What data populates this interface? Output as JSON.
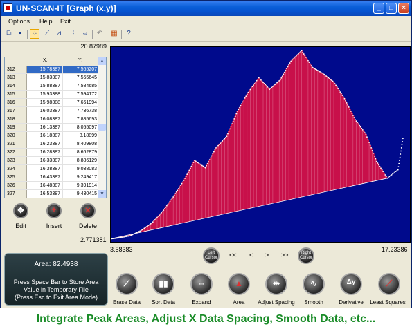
{
  "window": {
    "title": "UN-SCAN-IT [Graph (x,y)]",
    "buttons": {
      "minimize": "_",
      "maximize": "□",
      "close": "×"
    }
  },
  "menu": [
    "Options",
    "Help",
    "Exit"
  ],
  "axis": {
    "ymax": "20.87989",
    "ymin": "2.771381",
    "xmin": "3.58383",
    "xmax": "17.23386"
  },
  "table": {
    "columns": [
      "X:",
      "Y:"
    ],
    "rows": [
      [
        "312",
        "15.78387",
        "7.565207"
      ],
      [
        "313",
        "15.83387",
        "7.565645"
      ],
      [
        "314",
        "15.88387",
        "7.584685"
      ],
      [
        "315",
        "15.93388",
        "7.594172"
      ],
      [
        "316",
        "15.98388",
        "7.661994"
      ],
      [
        "317",
        "16.03387",
        "7.736738"
      ],
      [
        "318",
        "16.08387",
        "7.885693"
      ],
      [
        "319",
        "16.13387",
        "8.055097"
      ],
      [
        "320",
        "16.18387",
        "8.18899"
      ],
      [
        "321",
        "16.23387",
        "8.409808"
      ],
      [
        "322",
        "16.28387",
        "8.662879"
      ],
      [
        "323",
        "16.33387",
        "8.886129"
      ],
      [
        "324",
        "16.38387",
        "9.038083"
      ],
      [
        "325",
        "16.43387",
        "9.249417"
      ],
      [
        "326",
        "16.48387",
        "9.391914"
      ],
      [
        "327",
        "16.53387",
        "9.430415"
      ]
    ]
  },
  "edit_buttons": [
    "Edit",
    "Insert",
    "Delete"
  ],
  "cursor": {
    "left": "Left Cursor",
    "right": "Right Cursor",
    "nav": [
      "<<",
      "<",
      ">",
      ">>"
    ]
  },
  "area_panel": {
    "area": "Area: 82.4938",
    "line1": "Press Space Bar to Store Area",
    "line2": "Value in Temporary File",
    "line3": "(Press Esc to Exit Area Mode)"
  },
  "functions": [
    "Erase Data",
    "Sort Data",
    "Expand",
    "Area",
    "Adjust Spacing",
    "Smooth",
    "Derivative",
    "Least Squares"
  ],
  "caption": "Integrate Peak Areas, Adjust X Data Spacing, Smooth Data, etc...",
  "colors": {
    "plot_bg": "#000a8c",
    "fill": "#c8104a",
    "points": "#ffffff",
    "caption": "#1a8c28"
  },
  "chart_data": {
    "type": "area",
    "xlim": [
      3.58383,
      17.23386
    ],
    "ylim": [
      2.771381,
      20.87989
    ],
    "x": [
      3.58,
      4.0,
      4.5,
      5.0,
      5.5,
      6.0,
      6.5,
      7.0,
      7.5,
      8.0,
      8.5,
      9.0,
      9.5,
      10.0,
      10.5,
      11.0,
      11.5,
      12.0,
      12.5,
      13.0,
      13.5,
      14.0,
      14.5,
      15.0,
      15.5,
      16.0,
      16.5,
      17.0,
      17.23
    ],
    "y": [
      2.8,
      2.9,
      3.1,
      3.6,
      4.3,
      5.4,
      6.8,
      8.4,
      10.3,
      9.6,
      11.5,
      12.6,
      15.0,
      16.8,
      18.2,
      17.1,
      18.0,
      19.8,
      20.8,
      19.2,
      18.6,
      17.8,
      16.2,
      14.2,
      12.8,
      10.2,
      8.6,
      9.4,
      12.4
    ]
  }
}
